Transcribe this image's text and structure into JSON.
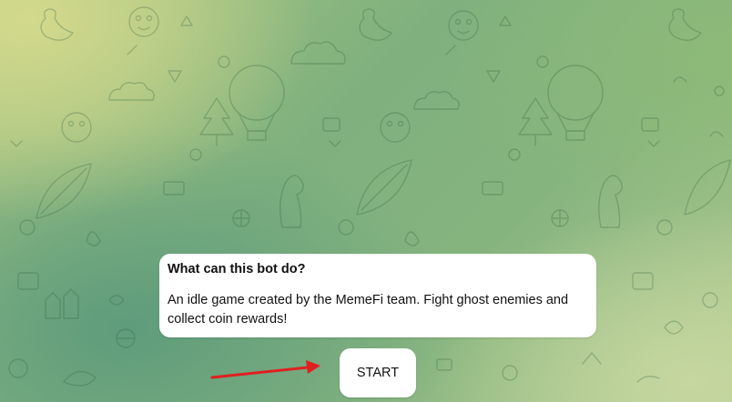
{
  "chat": {
    "background_colors": {
      "top_left": "#d3d98c",
      "mid": "#7fb07e",
      "bottom_right": "#c6d7a0"
    }
  },
  "bot_info": {
    "title": "What can this bot do?",
    "description": "An idle game created by the MemeFi team. Fight ghost enemies and collect coin rewards!"
  },
  "start_button": {
    "label": "START"
  },
  "annotation": {
    "arrow_color": "#e02020"
  }
}
